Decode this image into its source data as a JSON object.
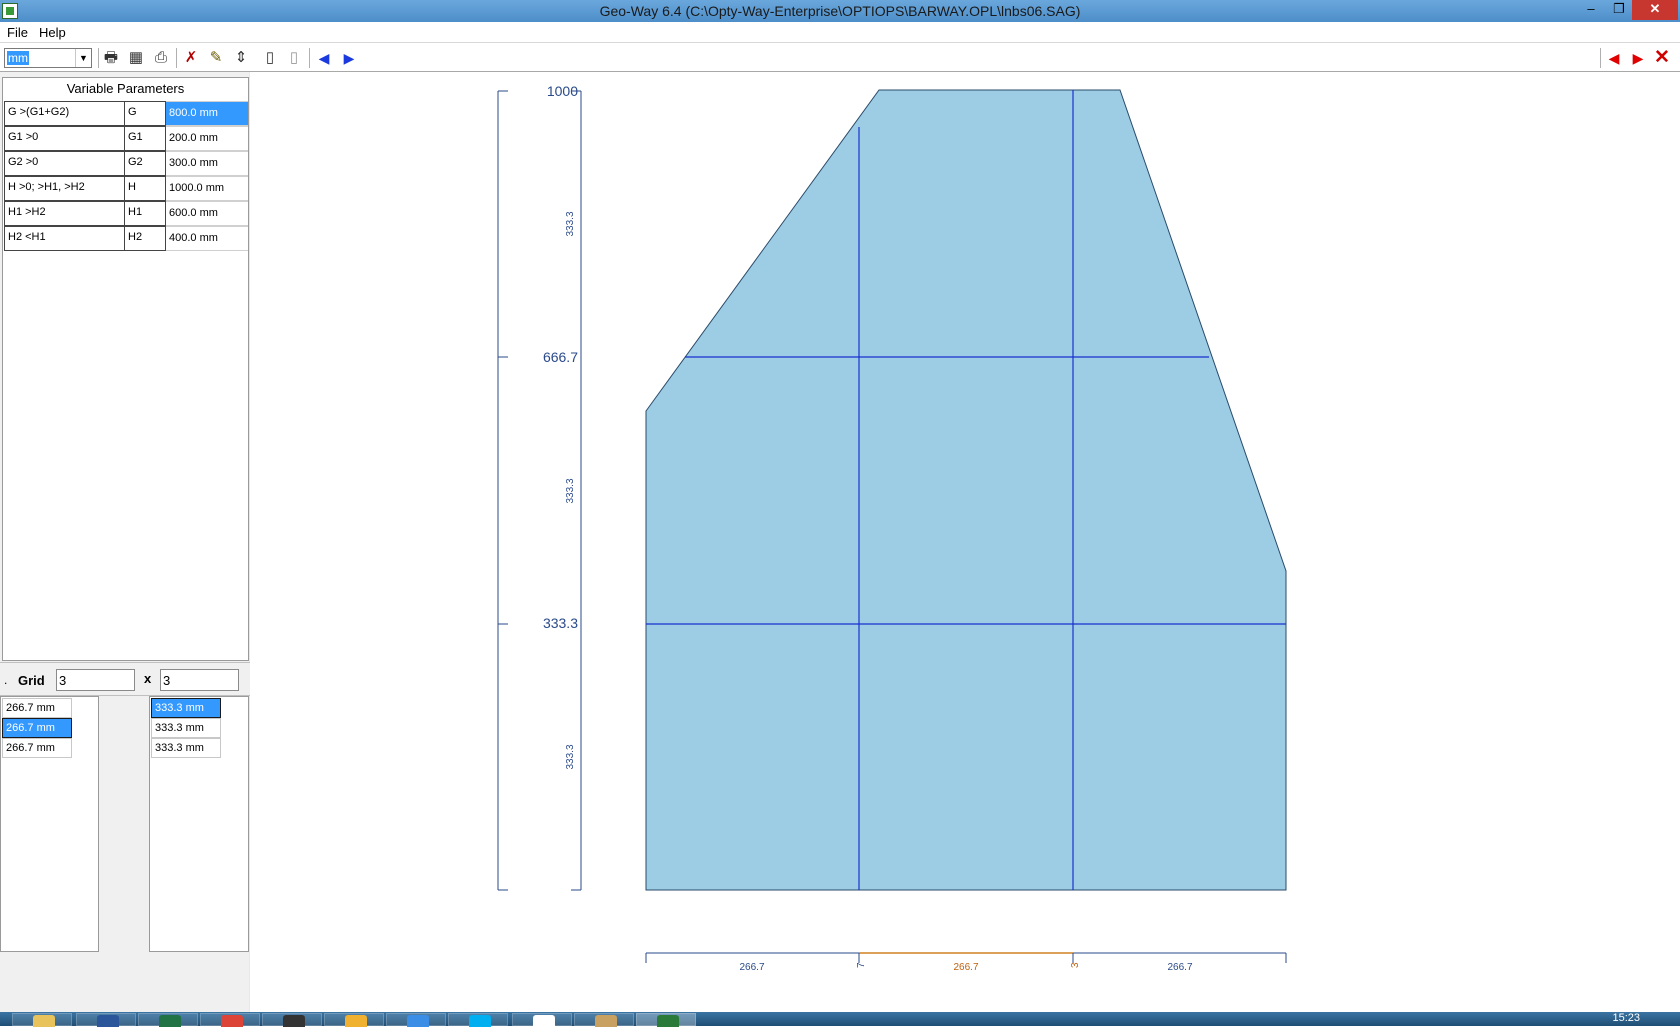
{
  "window": {
    "title": "Geo-Way 6.4 (C:\\Opty-Way-Enterprise\\OPTIOPS\\BARWAY.OPL\\lnbs06.SAG)",
    "minimize_glyph": "–",
    "maximize_glyph": "❐",
    "close_glyph": "✕"
  },
  "menu": [
    {
      "label": "File"
    },
    {
      "label": "Help"
    }
  ],
  "toolbar": {
    "unit_value": "mm",
    "icons": [
      "print-icon",
      "calculator-icon",
      "printer-alt-icon",
      "erase-pencil-icon",
      "edit-pencil-icon",
      "move-vertical-icon",
      "traffic-light-icon",
      "traffic-light-off-icon"
    ],
    "nav_left": "◀",
    "nav_right": "▶",
    "close": "✕"
  },
  "parameters": {
    "title": "Variable Parameters",
    "rows": [
      {
        "condition": "G >(G1+G2)",
        "name": "G",
        "value": "800.0 mm",
        "selected": true
      },
      {
        "condition": "G1 >0",
        "name": "G1",
        "value": "200.0 mm",
        "selected": false
      },
      {
        "condition": "G2 >0",
        "name": "G2",
        "value": "300.0 mm",
        "selected": false
      },
      {
        "condition": "H >0; >H1, >H2",
        "name": "H",
        "value": "1000.0 mm",
        "selected": false
      },
      {
        "condition": "H1 >H2",
        "name": "H1",
        "value": "600.0 mm",
        "selected": false
      },
      {
        "condition": "H2 <H1",
        "name": "H2",
        "value": "400.0 mm",
        "selected": false
      }
    ]
  },
  "grid": {
    "prefix": ".",
    "label": "Grid",
    "cols": "3",
    "separator": "x",
    "rows": "3",
    "col_widths": [
      "266.7 mm",
      "266.7 mm",
      "266.7 mm"
    ],
    "col_selected_index": 1,
    "row_heights": [
      "333.3 mm",
      "333.3 mm",
      "333.3 mm"
    ],
    "row_selected_index": 0
  },
  "drawing": {
    "fill_color": "#9ccde4",
    "grid_line_color": "#1a2fd0",
    "dim_color": "#2a4a8a",
    "vertical_ticks": [
      "1000",
      "666.7",
      "333.3"
    ],
    "vertical_spans": [
      "333.3",
      "333.3",
      "333.3"
    ],
    "horizontal_spans": [
      "266.7",
      "266.7",
      "266.7"
    ],
    "horizontal_markers": [
      "7",
      "3"
    ]
  },
  "taskbar": {
    "clock": "15:23"
  }
}
